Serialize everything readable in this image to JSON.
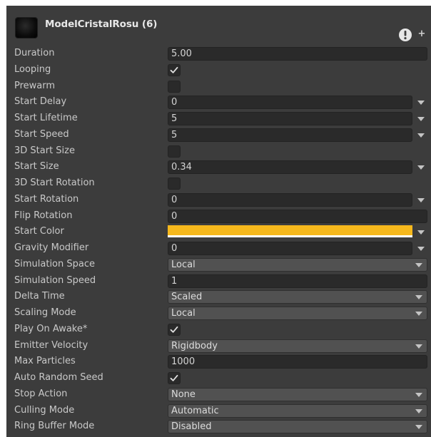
{
  "header": {
    "title": "ModelCristalRosu (6)"
  },
  "colors": {
    "start_color": "#f6b81c",
    "panel_bg": "#3c3c3c",
    "field_bg": "#2a2a2a",
    "dropdown_bg": "#515151"
  },
  "rows": [
    {
      "label": "Duration",
      "kind": "field",
      "value": "5.00"
    },
    {
      "label": "Looping",
      "kind": "checkbox",
      "checked": true
    },
    {
      "label": "Prewarm",
      "kind": "checkbox",
      "checked": false
    },
    {
      "label": "Start Delay",
      "kind": "field-arrow",
      "value": "0"
    },
    {
      "label": "Start Lifetime",
      "kind": "field-arrow",
      "value": "5"
    },
    {
      "label": "Start Speed",
      "kind": "field-arrow",
      "value": "5"
    },
    {
      "label": "3D Start Size",
      "kind": "checkbox",
      "checked": false
    },
    {
      "label": "Start Size",
      "kind": "field-arrow",
      "value": "0.34"
    },
    {
      "label": "3D Start Rotation",
      "kind": "checkbox",
      "checked": false
    },
    {
      "label": "Start Rotation",
      "kind": "field-arrow",
      "value": "0"
    },
    {
      "label": "Flip Rotation",
      "kind": "field",
      "value": "0"
    },
    {
      "label": "Start Color",
      "kind": "color"
    },
    {
      "label": "Gravity Modifier",
      "kind": "field-arrow",
      "value": "0"
    },
    {
      "label": "Simulation Space",
      "kind": "dropdown",
      "value": "Local"
    },
    {
      "label": "Simulation Speed",
      "kind": "field",
      "value": "1"
    },
    {
      "label": "Delta Time",
      "kind": "dropdown",
      "value": "Scaled"
    },
    {
      "label": "Scaling Mode",
      "kind": "dropdown",
      "value": "Local"
    },
    {
      "label": "Play On Awake*",
      "kind": "checkbox",
      "checked": true
    },
    {
      "label": "Emitter Velocity",
      "kind": "dropdown",
      "value": "Rigidbody"
    },
    {
      "label": "Max Particles",
      "kind": "field",
      "value": "1000"
    },
    {
      "label": "Auto Random Seed",
      "kind": "checkbox",
      "checked": true
    },
    {
      "label": "Stop Action",
      "kind": "dropdown",
      "value": "None"
    },
    {
      "label": "Culling Mode",
      "kind": "dropdown",
      "value": "Automatic"
    },
    {
      "label": "Ring Buffer Mode",
      "kind": "dropdown",
      "value": "Disabled"
    }
  ]
}
